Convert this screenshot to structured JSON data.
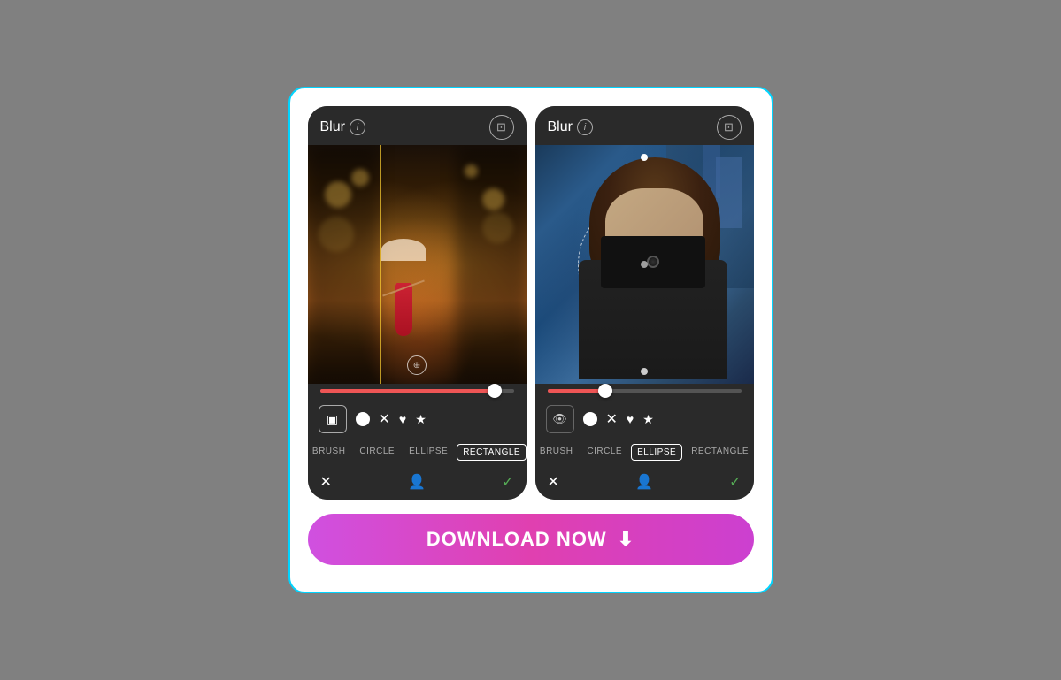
{
  "page": {
    "bg_color": "#808080"
  },
  "container": {
    "border_color": "#00d4ff"
  },
  "phones": [
    {
      "id": "left",
      "header": {
        "title": "Blur",
        "info_label": "i",
        "compare_label": "⇔"
      },
      "slider": {
        "fill_pct": "90%",
        "thumb_pct": "90%"
      },
      "tools": [
        {
          "name": "rectangle",
          "symbol": "▣",
          "active": true
        },
        {
          "name": "circle",
          "symbol": "●",
          "type": "filled"
        },
        {
          "name": "x",
          "symbol": "✕"
        },
        {
          "name": "heart",
          "symbol": "♥"
        },
        {
          "name": "star",
          "symbol": "★"
        }
      ],
      "shape_tabs": [
        {
          "label": "BRUSH",
          "active": false
        },
        {
          "label": "CIRCLE",
          "active": false
        },
        {
          "label": "ELLIPSE",
          "active": false
        },
        {
          "label": "RECTANGLE",
          "active": true
        }
      ],
      "bottom": {
        "cancel": "✕",
        "person": "👤",
        "check": "✓"
      }
    },
    {
      "id": "right",
      "header": {
        "title": "Blur",
        "info_label": "i",
        "compare_label": "⇔"
      },
      "slider": {
        "fill_pct": "30%",
        "thumb_pct": "30%"
      },
      "tools": [
        {
          "name": "eye",
          "symbol": "👁",
          "active": false
        },
        {
          "name": "circle",
          "symbol": "●",
          "type": "filled"
        },
        {
          "name": "x",
          "symbol": "✕"
        },
        {
          "name": "heart",
          "symbol": "♥"
        },
        {
          "name": "star",
          "symbol": "★"
        }
      ],
      "shape_tabs": [
        {
          "label": "BRUSH",
          "active": false
        },
        {
          "label": "CIRCLE",
          "active": false
        },
        {
          "label": "ELLIPSE",
          "active": true
        },
        {
          "label": "RECTANGLE",
          "active": false
        }
      ],
      "bottom": {
        "cancel": "✕",
        "person": "👤",
        "check": "✓"
      }
    }
  ],
  "download_button": {
    "label": "DOWNLOAD NOW",
    "icon": "⬇"
  }
}
